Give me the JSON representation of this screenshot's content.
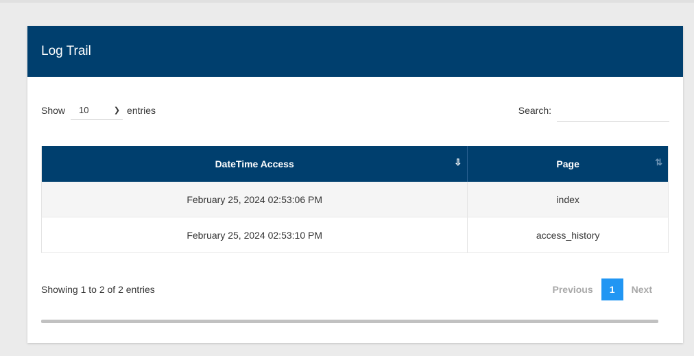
{
  "card": {
    "title": "Log Trail"
  },
  "length": {
    "label_before": "Show",
    "value": "10",
    "label_after": "entries"
  },
  "search": {
    "label": "Search:",
    "value": ""
  },
  "table": {
    "columns": [
      "DateTime Access",
      "Page"
    ],
    "rows": [
      [
        "February 25, 2024 02:53:06 PM",
        "index"
      ],
      [
        "February 25, 2024 02:53:10 PM",
        "access_history"
      ]
    ]
  },
  "info": "Showing 1 to 2 of 2 entries",
  "pager": {
    "previous": "Previous",
    "current": "1",
    "next": "Next"
  },
  "icons": {
    "sort_active": "sort-descending-icon",
    "sort_inactive": "sort-both-icon",
    "chevron": "chevron-down-icon"
  },
  "colors": {
    "header": "#003f6e",
    "page_active": "#2196f3"
  }
}
